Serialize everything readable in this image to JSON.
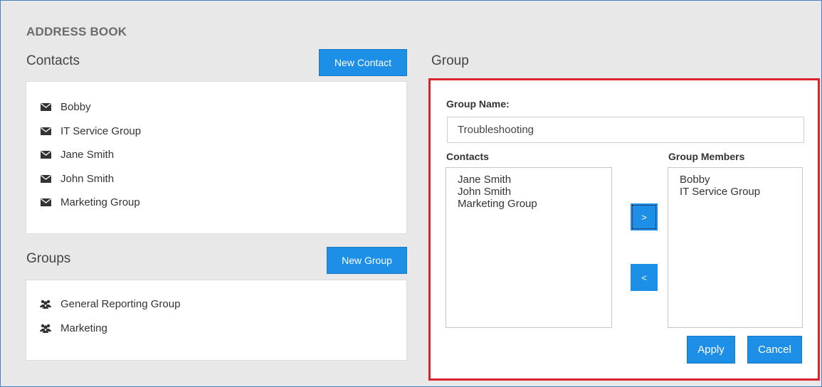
{
  "app": {
    "title": "ADDRESS BOOK"
  },
  "contacts_section": {
    "title": "Contacts",
    "new_button": "New Contact",
    "items": [
      "Bobby",
      "IT Service Group",
      "Jane Smith",
      "John Smith",
      "Marketing Group"
    ]
  },
  "groups_section": {
    "title": "Groups",
    "new_button": "New Group",
    "items": [
      "General Reporting Group",
      "Marketing"
    ]
  },
  "group_panel": {
    "title": "Group",
    "name_label": "Group Name:",
    "name_value": "Troubleshooting",
    "contacts_label": "Contacts",
    "members_label": "Group Members",
    "available_contacts": [
      "Jane Smith",
      "John Smith",
      "Marketing Group"
    ],
    "members": [
      "Bobby",
      "IT Service Group"
    ],
    "add_button": ">",
    "remove_button": "<",
    "apply_button": "Apply",
    "cancel_button": "Cancel"
  },
  "colors": {
    "accent": "#1d8fe6",
    "highlight_border": "#d9232d",
    "background": "#e8e8e8"
  },
  "icons": {
    "contact": "envelope-icon",
    "group": "users-icon"
  }
}
